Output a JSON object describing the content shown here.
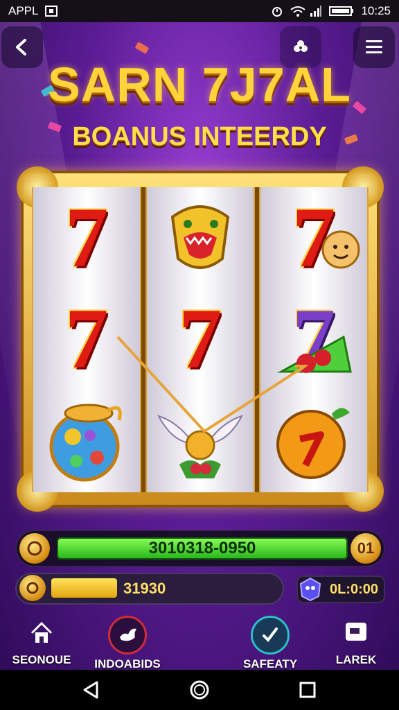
{
  "status_bar": {
    "app_label": "APPL",
    "time": "10:25"
  },
  "header": {
    "title": "SARN 7J7AL",
    "subtitle": "BOANUS INTEERDY"
  },
  "reels": {
    "rows": [
      [
        "seven",
        "monster-mask",
        "seven-with-face"
      ],
      [
        "seven",
        "seven",
        "cherry-wedge"
      ],
      [
        "treasure-orb",
        "winged-fruit",
        "orange-fruit"
      ]
    ]
  },
  "progress": {
    "main_value": "3010318-0950",
    "level_badge": "01",
    "secondary_value": "31930",
    "secondary_fill": 0.28,
    "chip_value": "0L:0:00"
  },
  "bottom_nav": {
    "items": [
      {
        "label": "SEONOUE",
        "icon": "home-icon"
      },
      {
        "label": "INDOABIDS",
        "icon": "bird-icon"
      },
      {
        "label": "SAFEATY",
        "icon": "shield-check-icon"
      },
      {
        "label": "LAREK",
        "icon": "chat-icon"
      }
    ]
  },
  "colors": {
    "accent_gold": "#ffd33a",
    "seven_red": "#e01b14",
    "progress_green": "#22b316",
    "bg_purple": "#5a1c93"
  }
}
